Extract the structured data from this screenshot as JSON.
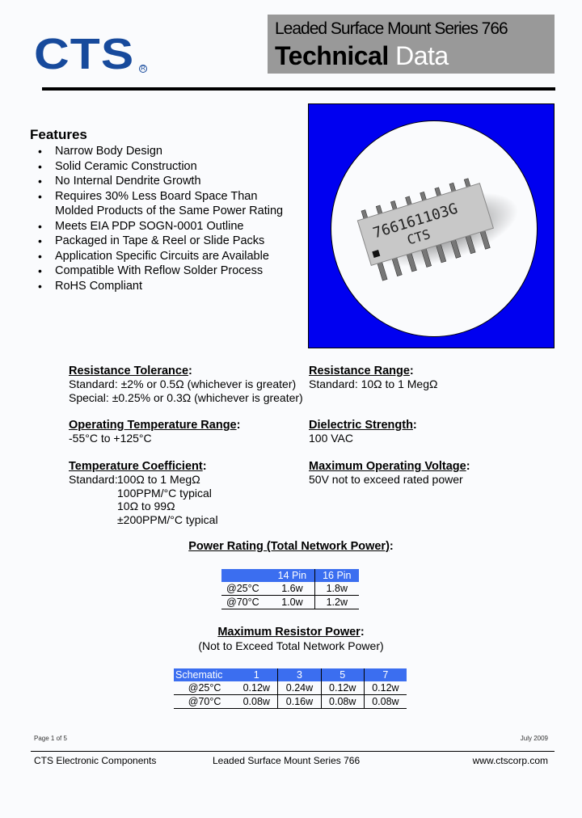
{
  "header": {
    "logo_text": "CTS",
    "logo_registered": "R",
    "series_title": "Leaded Surface Mount Series 766",
    "doc_title_bold": "Technical",
    "doc_title_light": "Data"
  },
  "features": {
    "heading": "Features",
    "items": [
      "Narrow Body Design",
      "Solid Ceramic Construction",
      "No Internal Dendrite Growth",
      "Requires 30% Less Board Space Than Molded Products of the Same Power Rating",
      "Meets EIA PDP SOGN-0001 Outline",
      "Packaged in Tape & Reel or Slide Packs",
      "Application Specific Circuits are Available",
      "Compatible With Reflow Solder Process",
      "RoHS Compliant"
    ]
  },
  "photo": {
    "part_marking_line1": "766161103G",
    "part_marking_line2": "CTS",
    "background_color": "#0000f0"
  },
  "specs": {
    "resistance_tolerance": {
      "heading": "Resistance Tolerance",
      "lines": [
        "Standard: ±2% or 0.5Ω (whichever is greater)",
        "Special: ±0.25% or 0.3Ω (whichever is greater)"
      ]
    },
    "resistance_range": {
      "heading": "Resistance Range",
      "lines": [
        "Standard: 10Ω to 1 MegΩ"
      ]
    },
    "operating_temperature": {
      "heading": "Operating Temperature Range",
      "lines": [
        "-55°C to +125°C"
      ]
    },
    "dielectric_strength": {
      "heading": "Dielectric Strength",
      "lines": [
        "100 VAC"
      ]
    },
    "temperature_coefficient": {
      "heading": "Temperature Coefficient",
      "label": "Standard:",
      "lines": [
        "100Ω to 1 MegΩ",
        "100PPM/°C typical",
        "10Ω to 99Ω",
        "±200PPM/°C typical"
      ]
    },
    "max_operating_voltage": {
      "heading": "Maximum Operating Voltage",
      "lines": [
        "50V not to exceed rated power"
      ]
    }
  },
  "power_rating": {
    "title": "Power Rating (Total Network Power)",
    "columns": [
      "",
      "14 Pin",
      "16 Pin"
    ],
    "rows": [
      [
        "@25°C",
        "1.6w",
        "1.8w"
      ],
      [
        "@70°C",
        "1.0w",
        "1.2w"
      ]
    ]
  },
  "max_resistor_power": {
    "title": "Maximum Resistor Power",
    "subtitle": "(Not to Exceed Total Network Power)",
    "columns": [
      "Schematic",
      "1",
      "3",
      "5",
      "7"
    ],
    "rows": [
      [
        "@25°C",
        "0.12w",
        "0.24w",
        "0.12w",
        "0.12w"
      ],
      [
        "@70°C",
        "0.08w",
        "0.16w",
        "0.08w",
        "0.08w"
      ]
    ]
  },
  "footer": {
    "page": "Page 1 of 5",
    "date": "July 2009",
    "company": "CTS Electronic Components",
    "series": "Leaded Surface Mount Series 766",
    "website": "www.ctscorp.com"
  },
  "colors": {
    "brand_blue": "#174a9c",
    "table_header_blue": "#3b6ef0",
    "title_box_gray": "#999999"
  }
}
